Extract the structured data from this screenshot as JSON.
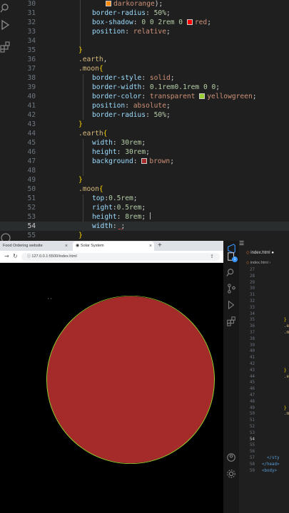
{
  "top_editor": {
    "lines": [
      {
        "num": "30",
        "indent": 2,
        "segments": [
          {
            "t": "swatch",
            "color": "#ff8c00"
          },
          {
            "t": "val",
            "text": "darkorange"
          },
          {
            "t": "punc",
            "text": ");"
          }
        ]
      },
      {
        "num": "31",
        "indent": 1,
        "segments": [
          {
            "t": "prop",
            "text": "border-radius"
          },
          {
            "t": "punc",
            "text": ": "
          },
          {
            "t": "num",
            "text": "50%"
          },
          {
            "t": "punc",
            "text": ";"
          }
        ]
      },
      {
        "num": "32",
        "indent": 1,
        "segments": [
          {
            "t": "prop",
            "text": "box-shadow"
          },
          {
            "t": "punc",
            "text": ": "
          },
          {
            "t": "num",
            "text": "0 0 2rem 0 "
          },
          {
            "t": "swatch",
            "color": "#ff0000"
          },
          {
            "t": "val",
            "text": "red"
          },
          {
            "t": "punc",
            "text": ";"
          }
        ]
      },
      {
        "num": "33",
        "indent": 1,
        "segments": [
          {
            "t": "prop",
            "text": "position"
          },
          {
            "t": "punc",
            "text": ": "
          },
          {
            "t": "val",
            "text": "relative"
          },
          {
            "t": "punc",
            "text": ";"
          }
        ]
      },
      {
        "num": "34",
        "indent": 0,
        "segments": []
      },
      {
        "num": "35",
        "indent": 0,
        "segments": [
          {
            "t": "brace",
            "text": "}"
          }
        ]
      },
      {
        "num": "36",
        "indent": 0,
        "segments": [
          {
            "t": "sel",
            "text": ".earth"
          },
          {
            "t": "punc",
            "text": ","
          }
        ]
      },
      {
        "num": "37",
        "indent": 0,
        "segments": [
          {
            "t": "sel",
            "text": ".moon"
          },
          {
            "t": "brace",
            "text": "{"
          }
        ]
      },
      {
        "num": "38",
        "indent": 1,
        "segments": [
          {
            "t": "prop",
            "text": "border-style"
          },
          {
            "t": "punc",
            "text": ": "
          },
          {
            "t": "val",
            "text": "solid"
          },
          {
            "t": "punc",
            "text": ";"
          }
        ]
      },
      {
        "num": "39",
        "indent": 1,
        "segments": [
          {
            "t": "prop",
            "text": "border-width"
          },
          {
            "t": "punc",
            "text": ": "
          },
          {
            "t": "num",
            "text": "0.1rem0.1rem 0 0"
          },
          {
            "t": "punc",
            "text": ";"
          }
        ]
      },
      {
        "num": "40",
        "indent": 1,
        "segments": [
          {
            "t": "prop",
            "text": "border-color"
          },
          {
            "t": "punc",
            "text": ": "
          },
          {
            "t": "val",
            "text": "transparent "
          },
          {
            "t": "swatch",
            "color": "#9acd32"
          },
          {
            "t": "val",
            "text": "yellowgreen"
          },
          {
            "t": "punc",
            "text": ";"
          }
        ]
      },
      {
        "num": "41",
        "indent": 1,
        "segments": [
          {
            "t": "prop",
            "text": "position"
          },
          {
            "t": "punc",
            "text": ": "
          },
          {
            "t": "val",
            "text": "absolute"
          },
          {
            "t": "punc",
            "text": ";"
          }
        ]
      },
      {
        "num": "42",
        "indent": 1,
        "segments": [
          {
            "t": "prop",
            "text": "border-radius"
          },
          {
            "t": "punc",
            "text": ": "
          },
          {
            "t": "num",
            "text": "50%"
          },
          {
            "t": "punc",
            "text": ";"
          }
        ]
      },
      {
        "num": "43",
        "indent": 0,
        "segments": [
          {
            "t": "brace",
            "text": "}"
          }
        ]
      },
      {
        "num": "44",
        "indent": 0,
        "segments": [
          {
            "t": "sel",
            "text": ".earth"
          },
          {
            "t": "brace",
            "text": "{"
          }
        ]
      },
      {
        "num": "45",
        "indent": 1,
        "segments": [
          {
            "t": "prop",
            "text": "width"
          },
          {
            "t": "punc",
            "text": ": "
          },
          {
            "t": "num",
            "text": "30rem"
          },
          {
            "t": "punc",
            "text": ";"
          }
        ]
      },
      {
        "num": "46",
        "indent": 1,
        "segments": [
          {
            "t": "prop",
            "text": "height"
          },
          {
            "t": "punc",
            "text": ": "
          },
          {
            "t": "num",
            "text": "30rem"
          },
          {
            "t": "punc",
            "text": ";"
          }
        ]
      },
      {
        "num": "47",
        "indent": 1,
        "segments": [
          {
            "t": "prop",
            "text": "background"
          },
          {
            "t": "punc",
            "text": ": "
          },
          {
            "t": "swatch",
            "color": "#a52a2a"
          },
          {
            "t": "val",
            "text": "brown"
          },
          {
            "t": "punc",
            "text": ";"
          }
        ]
      },
      {
        "num": "48",
        "indent": 0,
        "segments": []
      },
      {
        "num": "49",
        "indent": 0,
        "segments": [
          {
            "t": "brace",
            "text": "}"
          }
        ]
      },
      {
        "num": "50",
        "indent": 0,
        "segments": [
          {
            "t": "sel",
            "text": ".moon"
          },
          {
            "t": "brace",
            "text": "{"
          }
        ]
      },
      {
        "num": "51",
        "indent": 1,
        "segments": [
          {
            "t": "prop",
            "text": "top"
          },
          {
            "t": "punc",
            "text": ":"
          },
          {
            "t": "num",
            "text": "0.5rem"
          },
          {
            "t": "punc",
            "text": ";"
          }
        ]
      },
      {
        "num": "52",
        "indent": 1,
        "segments": [
          {
            "t": "prop",
            "text": "right"
          },
          {
            "t": "punc",
            "text": ":"
          },
          {
            "t": "num",
            "text": "0.5rem"
          },
          {
            "t": "punc",
            "text": ";"
          }
        ]
      },
      {
        "num": "53",
        "indent": 1,
        "segments": [
          {
            "t": "prop",
            "text": "height"
          },
          {
            "t": "punc",
            "text": ": "
          },
          {
            "t": "num",
            "text": "8rem"
          },
          {
            "t": "punc",
            "text": ";"
          }
        ]
      },
      {
        "num": "54",
        "indent": 1,
        "current": true,
        "segments": [
          {
            "t": "prop",
            "text": "width"
          },
          {
            "t": "punc",
            "text": ": ;"
          }
        ]
      },
      {
        "num": "55",
        "indent": 0,
        "segments": [
          {
            "t": "brace",
            "text": "}"
          }
        ]
      }
    ]
  },
  "browser": {
    "tabs": [
      {
        "label": "Food Ordering website",
        "active": false
      },
      {
        "label": "Solar System",
        "active": true
      }
    ],
    "tab_close": "×",
    "new_tab": "+",
    "address": "127.0.0.1:5500/index.html",
    "viewport_bg": "#000000",
    "earth_color": "#a52a2a",
    "moon_border_color": "#9acd32"
  },
  "right_editor": {
    "tab_label": "index.html",
    "breadcrumb": "index.html",
    "notification_badge": "1",
    "lines": [
      {
        "num": "27",
        "code": ""
      },
      {
        "num": "28",
        "code": ""
      },
      {
        "num": "29",
        "code": ""
      },
      {
        "num": "30",
        "code": ""
      },
      {
        "num": "31",
        "code": ""
      },
      {
        "num": "32",
        "code": ""
      },
      {
        "num": "33",
        "code": ""
      },
      {
        "num": "34",
        "code": ""
      },
      {
        "num": "35",
        "code": "}"
      },
      {
        "num": "36",
        "code": ".e"
      },
      {
        "num": "37",
        "code": ".m"
      },
      {
        "num": "38",
        "code": ""
      },
      {
        "num": "39",
        "code": ""
      },
      {
        "num": "40",
        "code": ""
      },
      {
        "num": "41",
        "code": ""
      },
      {
        "num": "42",
        "code": ""
      },
      {
        "num": "43",
        "code": "}"
      },
      {
        "num": "44",
        "code": ".e"
      },
      {
        "num": "45",
        "code": ""
      },
      {
        "num": "46",
        "code": ""
      },
      {
        "num": "47",
        "code": ""
      },
      {
        "num": "48",
        "code": ""
      },
      {
        "num": "49",
        "code": "}"
      },
      {
        "num": "50",
        "code": ".m"
      },
      {
        "num": "51",
        "code": ""
      },
      {
        "num": "52",
        "code": ""
      },
      {
        "num": "53",
        "code": ""
      },
      {
        "num": "54",
        "code": ""
      },
      {
        "num": "55",
        "code": ""
      },
      {
        "num": "56",
        "code": ""
      },
      {
        "num": "57",
        "code": "  </sty"
      },
      {
        "num": "58",
        "code": "</head>"
      },
      {
        "num": "59",
        "code": "<body>"
      }
    ],
    "current_line": "54"
  }
}
